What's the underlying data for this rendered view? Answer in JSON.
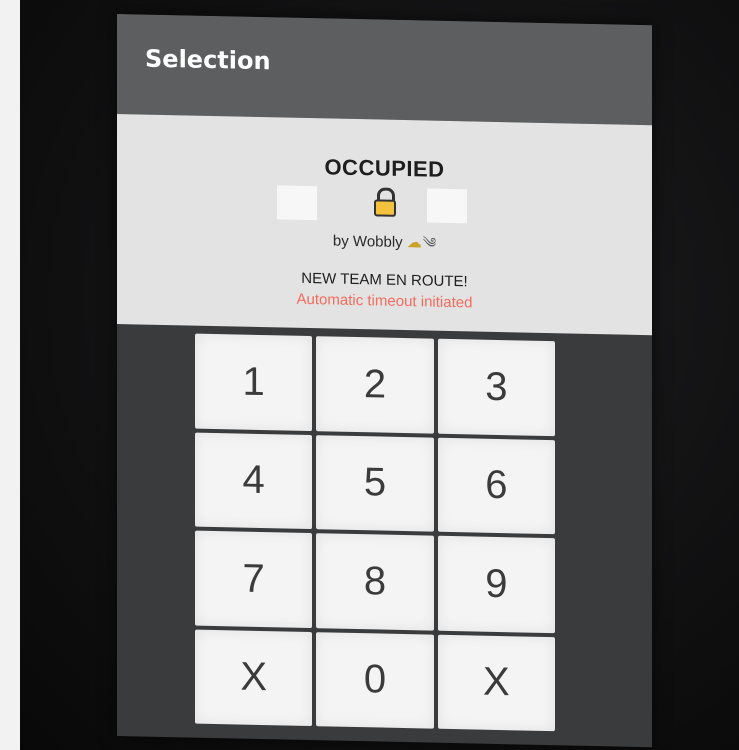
{
  "window": {
    "title": "Selection"
  },
  "status": {
    "state": "OCCUPIED",
    "lock_icon": "lock-icon",
    "occupied_by": "by Wobbly",
    "weather_icons": [
      "partly-cloudy-icon",
      "wind-icon"
    ],
    "message": "NEW TEAM EN ROUTE!",
    "timeout_message": "Automatic timeout initiated",
    "timeout_color": "#f16c5e"
  },
  "keypad": {
    "keys": [
      "1",
      "2",
      "3",
      "4",
      "5",
      "6",
      "7",
      "8",
      "9",
      "X",
      "0",
      "X"
    ]
  },
  "colors": {
    "titlebar": "#5d5e60",
    "status_panel": "#e3e3e3",
    "keypad_bg": "#3a3b3d",
    "lock_fill": "#f4c23c"
  }
}
